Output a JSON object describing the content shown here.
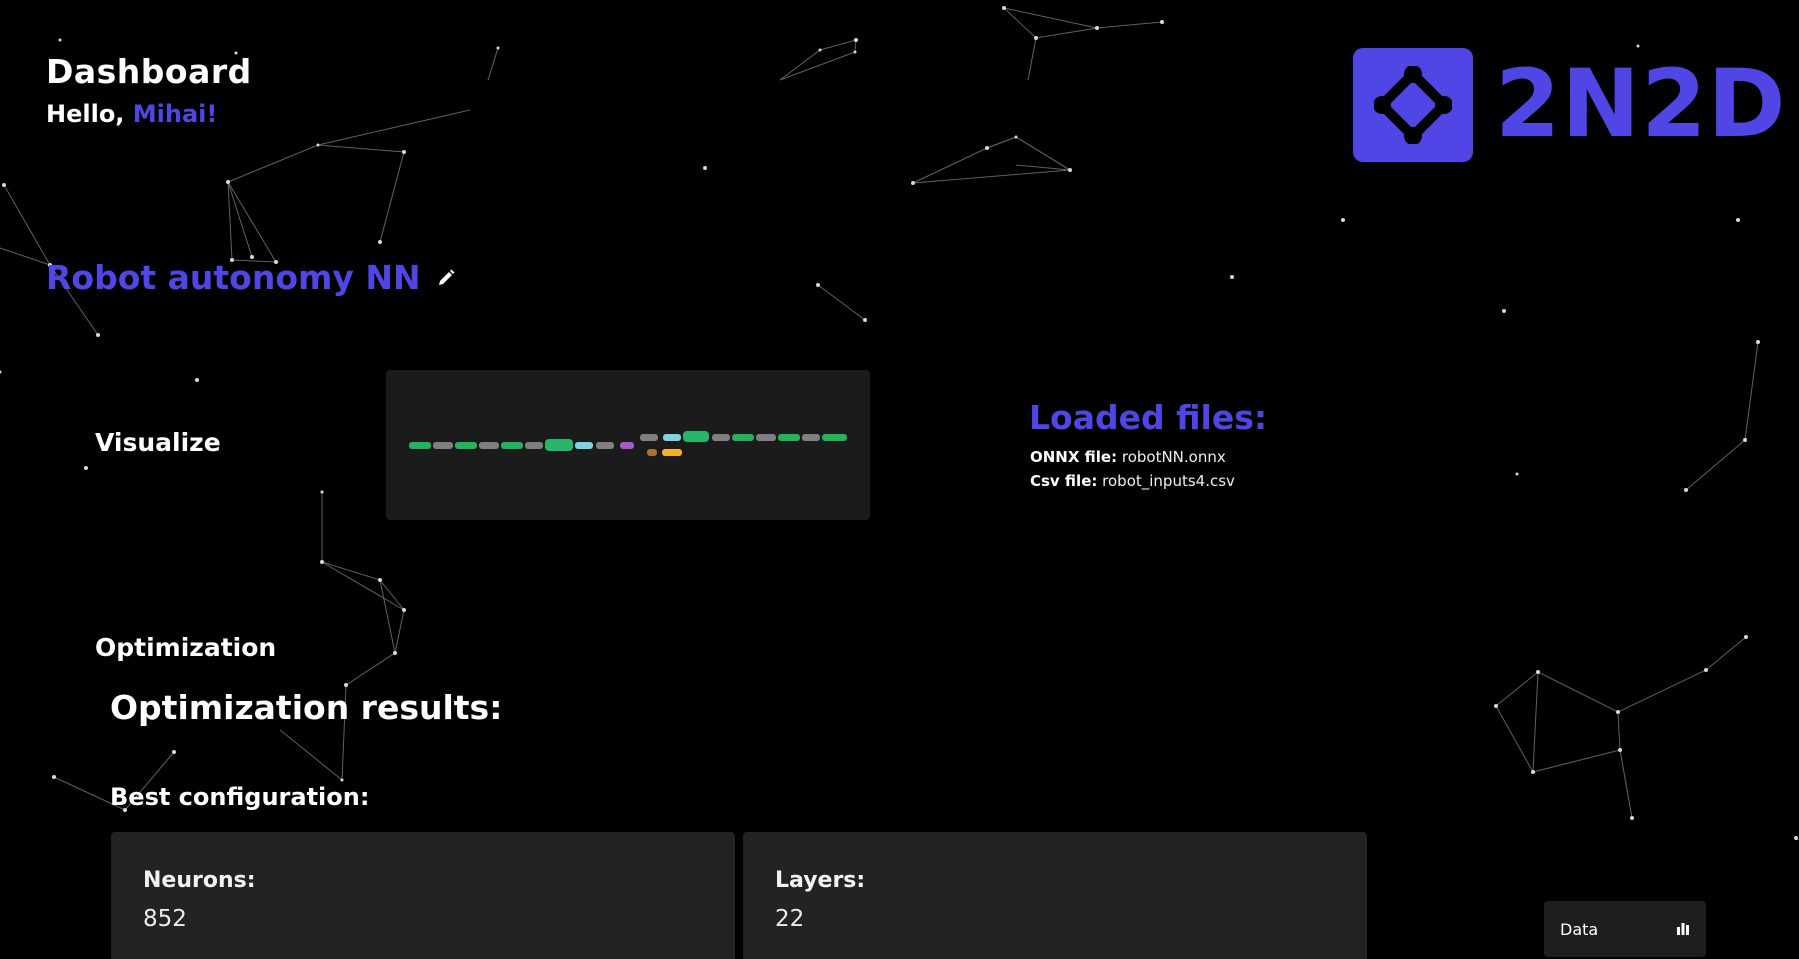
{
  "theme": {
    "accent": "#4f46e5",
    "background": "#000000"
  },
  "header": {
    "title": "Dashboard",
    "greeting_prefix": "Hello, ",
    "username": "Mihai!"
  },
  "logo": {
    "text": "2N2D",
    "icon": "network-diamond-icon"
  },
  "project": {
    "name": "Robot autonomy NN",
    "edit_icon": "pencil-icon"
  },
  "sections": {
    "visualize": "Visualize",
    "optimization": "Optimization"
  },
  "loaded_files": {
    "title": "Loaded files:",
    "onnx_label": "ONNX file:",
    "onnx_value": "robotNN.onnx",
    "csv_label": "Csv file:",
    "csv_value": "robot_inputs4.csv"
  },
  "optimization": {
    "results_title": "Optimization results:",
    "best_config_title": "Best configuration:",
    "neurons_label": "Neurons:",
    "neurons_value": "852",
    "layers_label": "Layers:",
    "layers_value": "22"
  },
  "data_button": {
    "label": "Data",
    "icon": "bar-chart-icon"
  }
}
